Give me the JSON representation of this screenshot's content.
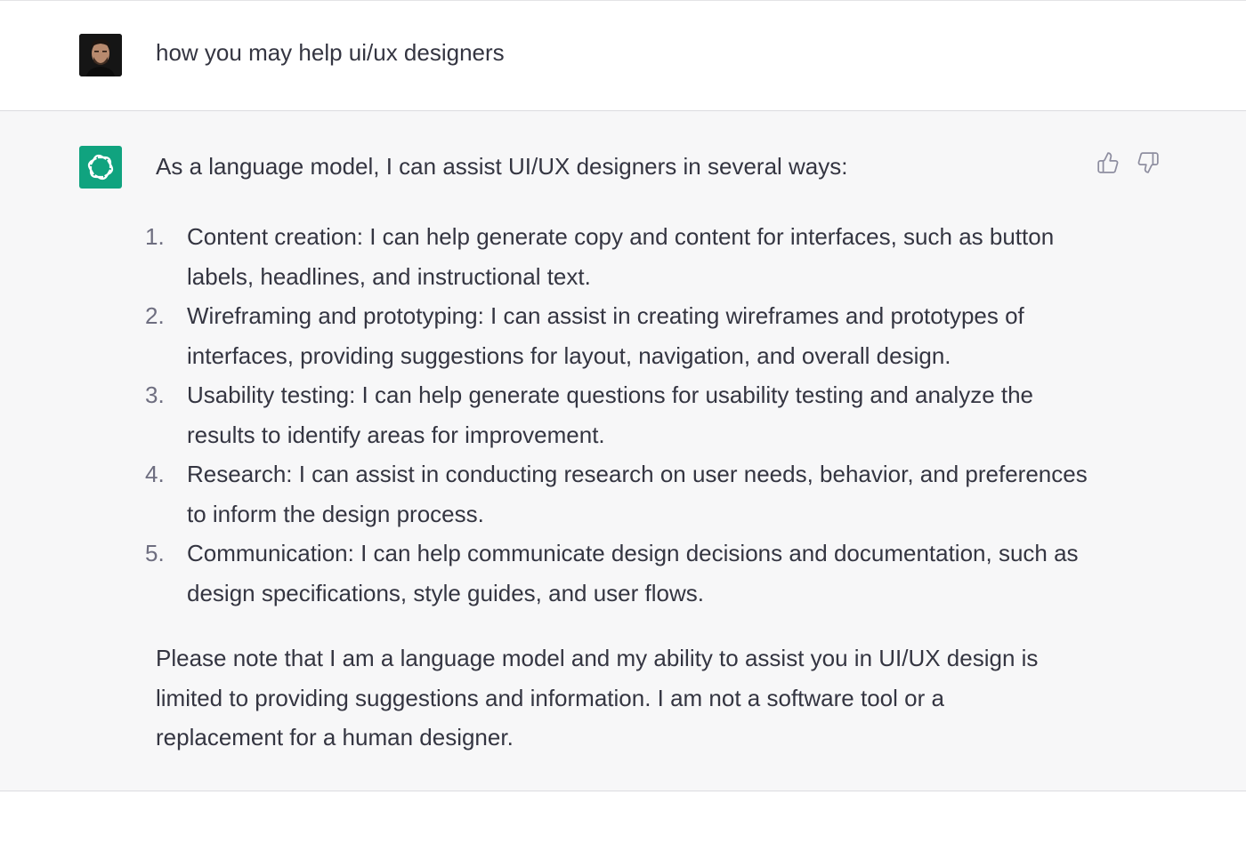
{
  "conversation": {
    "user_message": {
      "avatar_icon": "user-avatar",
      "text": "how you may help ui/ux designers"
    },
    "assistant_message": {
      "avatar_icon": "openai-logo-icon",
      "accent_color": "#10a37f",
      "intro": "As a language model, I can assist UI/UX designers in several ways:",
      "items": [
        {
          "number": "1.",
          "line1": "Content creation: I can help generate copy and content for interfaces, such as button",
          "line2": "labels, headlines, and instructional text."
        },
        {
          "number": "2.",
          "line1": "Wireframing and prototyping: I can assist in creating wireframes and prototypes of",
          "line2": "interfaces, providing suggestions for layout, navigation, and overall design."
        },
        {
          "number": "3.",
          "line1": "Usability testing: I can help generate questions for usability testing and analyze the",
          "line2": "results to identify areas for improvement."
        },
        {
          "number": "4.",
          "line1": "Research: I can assist in conducting research on user needs, behavior, and preferences",
          "line2": "to inform the design process."
        },
        {
          "number": "5.",
          "line1": "Communication: I can help communicate design decisions and documentation, such as",
          "line2": "design specifications, style guides, and user flows."
        }
      ],
      "note_lines": [
        "Please note that I am a language model and my ability to assist you in UI/UX design is",
        "limited to providing suggestions and information. I am not a software tool or a",
        "replacement for a human designer."
      ],
      "feedback": {
        "thumbs_up_icon": "thumbs-up-icon",
        "thumbs_down_icon": "thumbs-down-icon"
      }
    }
  }
}
